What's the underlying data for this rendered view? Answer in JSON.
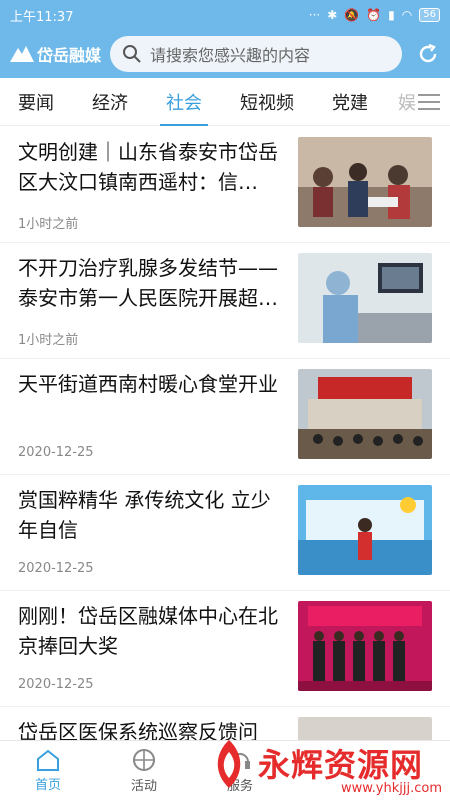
{
  "status": {
    "time": "上午11:37",
    "battery": "56"
  },
  "header": {
    "app_name": "岱岳融媒",
    "search_placeholder": "请搜索您感兴趣的内容"
  },
  "tabs": [
    {
      "label": "要闻"
    },
    {
      "label": "经济"
    },
    {
      "label": "社会",
      "active": true
    },
    {
      "label": "短视频"
    },
    {
      "label": "党建"
    },
    {
      "label": "娱"
    }
  ],
  "news": [
    {
      "title": "文明创建｜山东省泰安市岱岳区大汶口镇南西遥村：信…",
      "time": "1小时之前"
    },
    {
      "title": "不开刀治疗乳腺多发结节——泰安市第一人民医院开展超…",
      "time": "1小时之前"
    },
    {
      "title": "天平街道西南村暖心食堂开业",
      "time": "2020-12-25"
    },
    {
      "title": "赏国粹精华  承传统文化  立少年自信",
      "time": "2020-12-25"
    },
    {
      "title": "刚刚！岱岳区融媒体中心在北京捧回大奖",
      "time": "2020-12-25"
    },
    {
      "title": "岱岳区医保系统巡察反馈问",
      "time": ""
    }
  ],
  "bottom_nav": [
    {
      "label": "首页",
      "icon": "home-icon",
      "active": true
    },
    {
      "label": "活动",
      "icon": "basketball-icon"
    },
    {
      "label": "服务",
      "icon": "service-icon"
    }
  ],
  "watermark": {
    "text": "永辉资源网",
    "url": "www.yhkjjj.com"
  },
  "colors": {
    "header": "#6fb9ea",
    "accent": "#3aa0dd",
    "watermark": "#e52b2b"
  }
}
